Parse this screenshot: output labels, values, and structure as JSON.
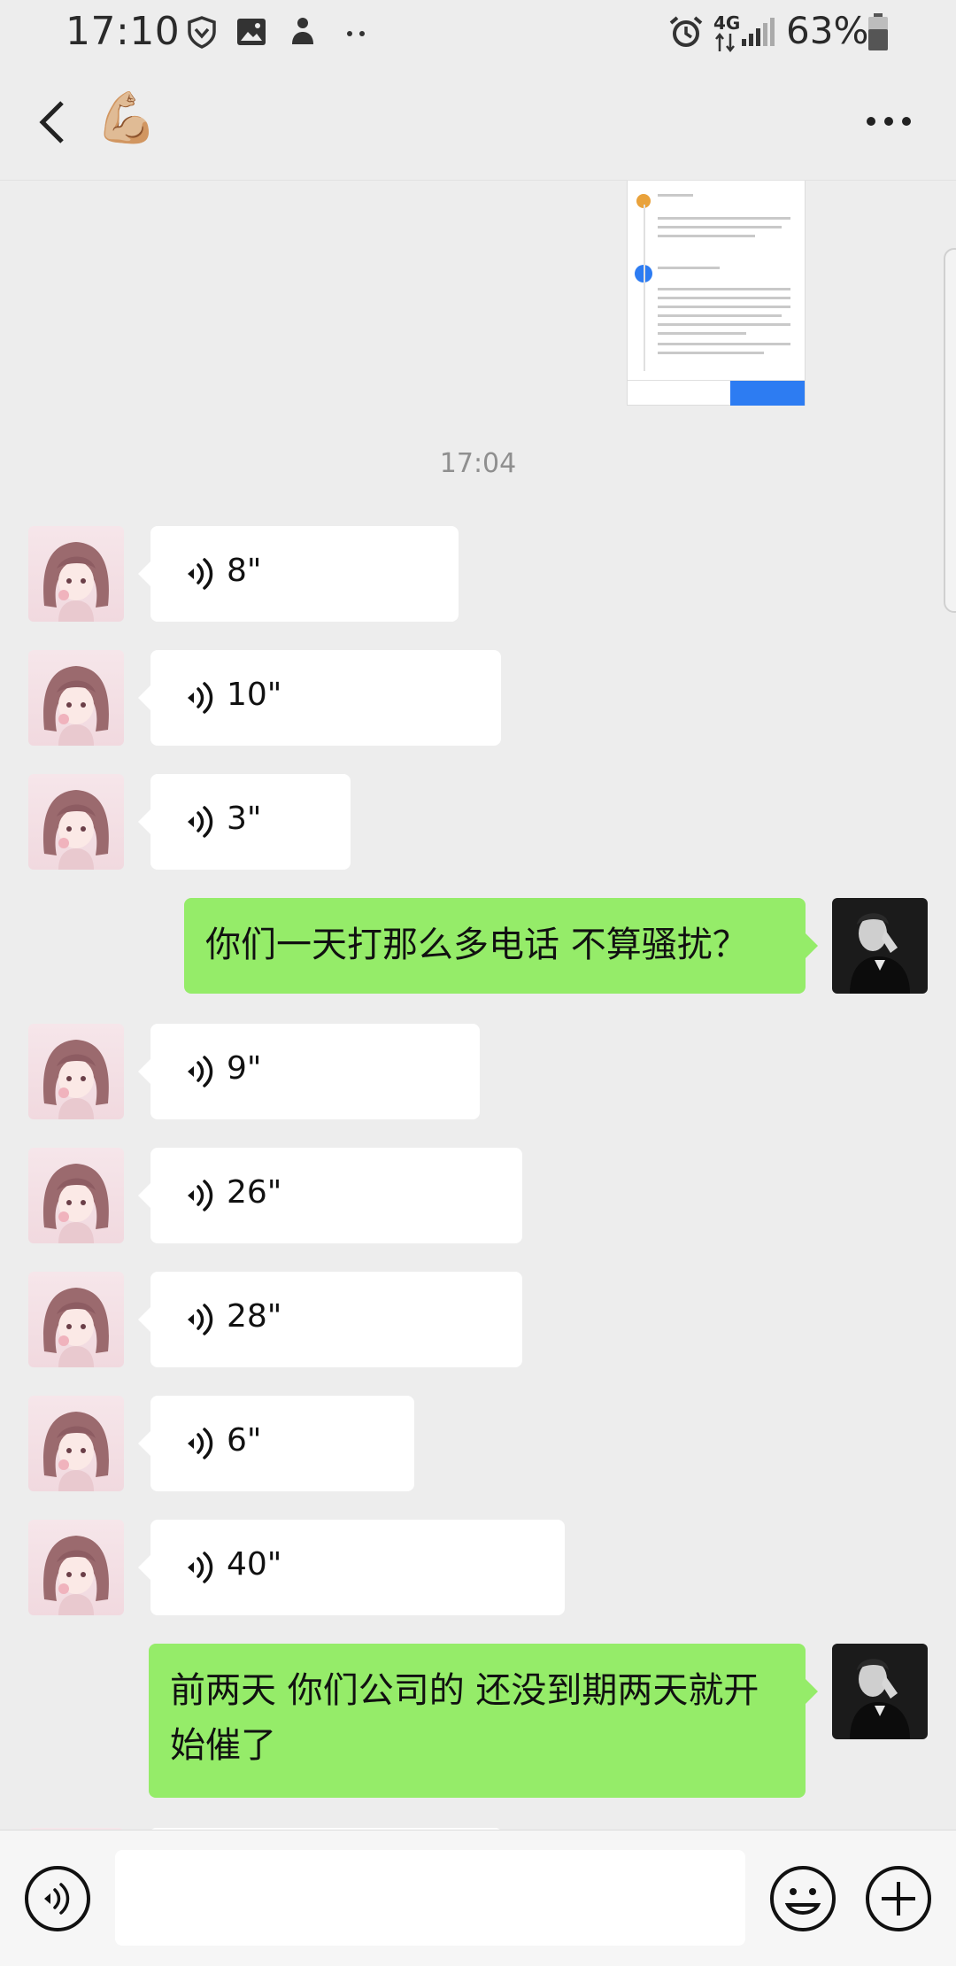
{
  "status_bar": {
    "time": "17:10",
    "battery_percent": "63%",
    "network": "4G"
  },
  "header": {
    "back": "back",
    "title_emoji": "💪🏼",
    "more": "more"
  },
  "chat": {
    "timestamp": "17:04",
    "messages": [
      {
        "sender": "left",
        "type": "voice",
        "duration": "8\""
      },
      {
        "sender": "left",
        "type": "voice",
        "duration": "10\""
      },
      {
        "sender": "left",
        "type": "voice",
        "duration": "3\""
      },
      {
        "sender": "right",
        "type": "text",
        "text": "你们一天打那么多电话 不算骚扰？"
      },
      {
        "sender": "left",
        "type": "voice",
        "duration": "9\""
      },
      {
        "sender": "left",
        "type": "voice",
        "duration": "26\""
      },
      {
        "sender": "left",
        "type": "voice",
        "duration": "28\""
      },
      {
        "sender": "left",
        "type": "voice",
        "duration": "6\""
      },
      {
        "sender": "left",
        "type": "voice",
        "duration": "40\""
      },
      {
        "sender": "right",
        "type": "text",
        "text": "前两天 你们公司的  还没到期两天就开始催了"
      }
    ]
  },
  "colors": {
    "background": "#ededed",
    "sent_bubble": "#95ec69",
    "received_bubble": "#ffffff",
    "accent_blue": "#2d7cf2"
  },
  "icons": {
    "status": [
      "shield-icon",
      "image-icon",
      "person-icon",
      "alarm-icon",
      "signal-icon",
      "battery-icon"
    ],
    "input_bar": [
      "voice-mode-icon",
      "emoji-icon",
      "plus-icon"
    ]
  }
}
